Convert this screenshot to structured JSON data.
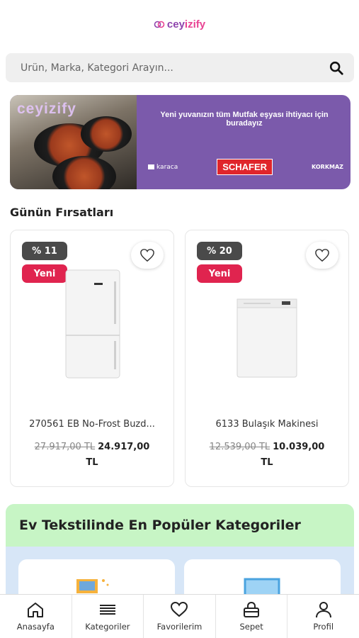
{
  "header": {
    "logo_text_1": "cey",
    "logo_text_2": "iz",
    "logo_text_3": "ify",
    "logo_full": "ceyizify"
  },
  "search": {
    "placeholder": "Ürün, Marka, Kategori Arayın..."
  },
  "banner": {
    "watermark": "ceyizify",
    "tagline": "Yeni yuvanızın tüm Mutfak eşyası ihtiyacı için buradayız",
    "brands": [
      "karaca",
      "SCHAFER",
      "KORKMAZ"
    ]
  },
  "deals": {
    "title": "Günün Fırsatları",
    "products": [
      {
        "discount": "% 11",
        "badge": "Yeni",
        "name": "270561 EB No-Frost Buzd...",
        "old_price": "27.917,00 TL",
        "new_price": "24.917,00",
        "currency": "TL"
      },
      {
        "discount": "% 20",
        "badge": "Yeni",
        "name": "6133 Bulaşık Makinesi",
        "old_price": "12.539,00 TL",
        "new_price": "10.039,00",
        "currency": "TL"
      }
    ]
  },
  "textile": {
    "title": "Ev Tekstilinde En Popüler Kategoriler"
  },
  "tabbar": {
    "items": [
      {
        "label": "Anasayfa",
        "icon": "home-icon"
      },
      {
        "label": "Kategoriler",
        "icon": "menu-icon"
      },
      {
        "label": "Favorilerim",
        "icon": "heart-icon"
      },
      {
        "label": "Sepet",
        "icon": "bag-icon"
      },
      {
        "label": "Profil",
        "icon": "user-icon"
      }
    ]
  },
  "colors": {
    "discount_badge": "#4a4a4a",
    "new_badge": "#e0244f",
    "banner_purple": "#7b5aab",
    "textile_header": "#c7f5c5",
    "textile_body": "#d7e6f7"
  }
}
